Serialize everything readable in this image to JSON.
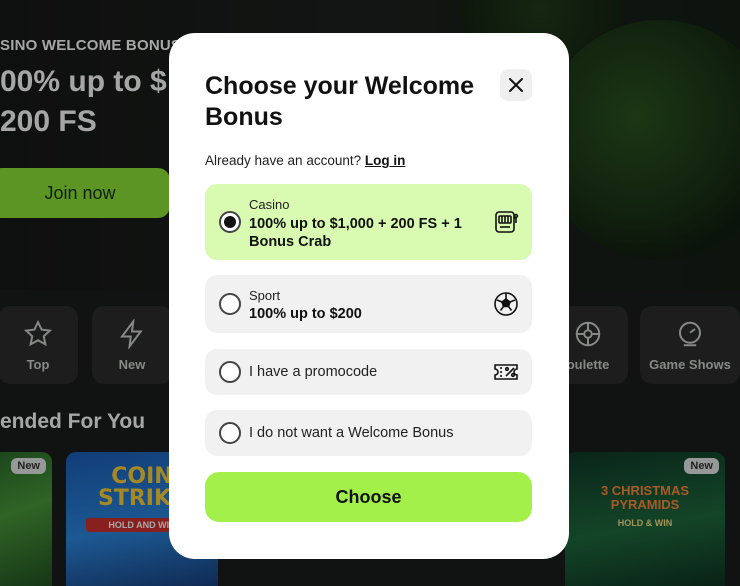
{
  "background": {
    "hero": {
      "eyebrow": "SINO WELCOME BONUS",
      "title_line1": "00% up to $",
      "title_line2": "200 FS",
      "join_label": "Join now"
    },
    "categories": [
      {
        "label": "Top",
        "icon": "star-icon"
      },
      {
        "label": "New",
        "icon": "lightning-icon"
      },
      {
        "label": "oulette",
        "icon": "roulette-icon"
      },
      {
        "label": "Game Shows",
        "icon": "game-shows-icon"
      }
    ],
    "section_title": "ended For You",
    "games": [
      {
        "badge": "New"
      },
      {
        "title": "COIN STRIKE",
        "subtitle": "HOLD AND WIN"
      },
      {
        "title": "3 CHRISTMAS PYRAMIDS",
        "subtitle": "HOLD & WIN",
        "badge": "New"
      }
    ]
  },
  "modal": {
    "title": "Choose your Welcome Bonus",
    "account_prompt": "Already have an account?",
    "login_link": "Log in",
    "options": [
      {
        "category": "Casino",
        "label": "100% up to $1,000 + 200 FS + 1 Bonus Crab",
        "selected": true,
        "icon": "slot-machine-icon"
      },
      {
        "category": "Sport",
        "label": "100% up to $200",
        "selected": false,
        "icon": "soccer-ball-icon"
      },
      {
        "label": "I have a promocode",
        "selected": false,
        "icon": "promo-ticket-icon"
      },
      {
        "label": "I do not want a Welcome Bonus",
        "selected": false
      }
    ],
    "choose_label": "Choose"
  },
  "colors": {
    "accent": "#a3f04a",
    "selected_bg": "#d9fbb1",
    "option_bg": "#f1f1f1"
  }
}
